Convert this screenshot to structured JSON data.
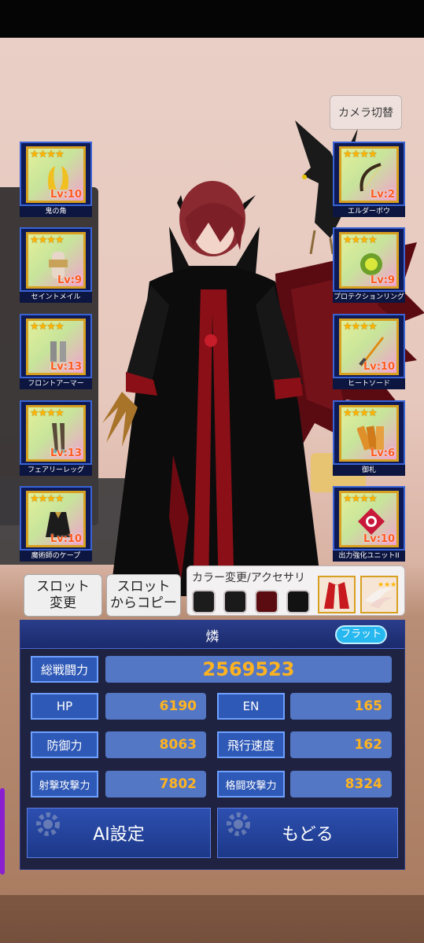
{
  "camera_button": "カメラ切替",
  "equipment_left": [
    {
      "name": "鬼の角",
      "stars": "★★★★",
      "level": "Lv:10",
      "icon": "horns-icon"
    },
    {
      "name": "セイントメイル",
      "stars": "★★★★",
      "level": "Lv:9",
      "icon": "armor-doll-icon"
    },
    {
      "name": "フロントアーマー",
      "stars": "★★★★",
      "level": "Lv:13",
      "icon": "front-armor-icon"
    },
    {
      "name": "フェアリーレッグ",
      "stars": "★★★★",
      "level": "Lv:13",
      "icon": "legs-icon"
    },
    {
      "name": "魔術師のケープ",
      "stars": "★★★★",
      "level": "Lv:10",
      "icon": "cape-icon"
    }
  ],
  "equipment_right": [
    {
      "name": "エルダーボウ",
      "stars": "★★★★",
      "level": "Lv:2",
      "icon": "bow-icon"
    },
    {
      "name": "プロテクションリング",
      "stars": "★★★★",
      "level": "Lv:9",
      "icon": "ring-icon"
    },
    {
      "name": "ヒートソード",
      "stars": "★★★★",
      "level": "Lv:10",
      "icon": "sword-icon"
    },
    {
      "name": "御札",
      "stars": "★★★★",
      "level": "Lv:6",
      "icon": "talisman-icon"
    },
    {
      "name": "出力強化ユニットII",
      "stars": "★★★★",
      "level": "Lv:10",
      "icon": "power-unit-icon"
    }
  ],
  "slot_change": "スロット\n変更",
  "slot_copy": "スロット\nからコピー",
  "color_panel": {
    "title": "カラー変更/アクセサリ",
    "swatches": [
      "#1c1c1c",
      "#1a1a1a",
      "#5a0c10",
      "#121212"
    ]
  },
  "character": {
    "name": "燐",
    "mode_badge": "フラット"
  },
  "stats": {
    "total_label": "総戦闘力",
    "total_value": "2569523",
    "hp_label": "HP",
    "hp_value": "6190",
    "en_label": "EN",
    "en_value": "165",
    "def_label": "防御力",
    "def_value": "8063",
    "speed_label": "飛行速度",
    "speed_value": "162",
    "shoot_label": "射撃攻撃力",
    "shoot_value": "7802",
    "melee_label": "格闘攻撃力",
    "melee_value": "8324"
  },
  "buttons": {
    "ai": "AI設定",
    "back": "もどる"
  },
  "colors": {
    "panel_bg": "#121a3e",
    "label_bg": "#2f59b6",
    "value_text": "#ffb320",
    "badge": "#27b8f0"
  }
}
